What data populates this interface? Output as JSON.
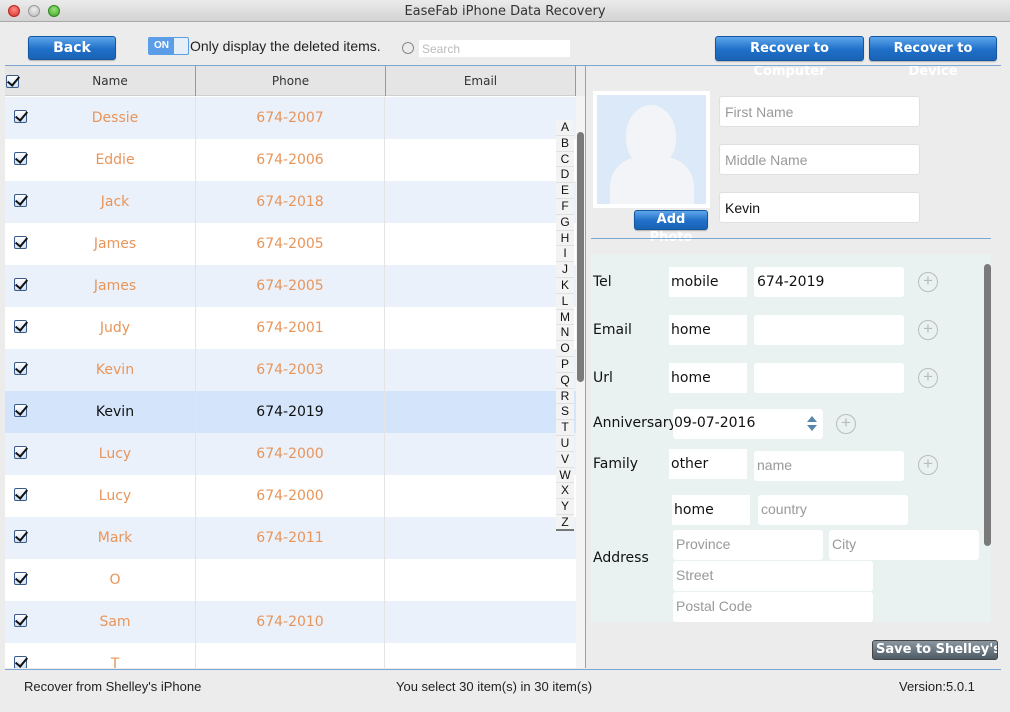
{
  "window": {
    "title": "EaseFab iPhone Data Recovery"
  },
  "toolbar": {
    "back_label": "Back",
    "toggle_state": "ON",
    "toggle_label": "Only display the deleted items.",
    "search_placeholder": "Search",
    "recover_computer_label": "Recover to Computer",
    "recover_device_label": "Recover to Device"
  },
  "table": {
    "headers": [
      "Name",
      "Phone",
      "Email"
    ],
    "rows": [
      {
        "name": "Dessie",
        "phone": "674-2007",
        "email": ""
      },
      {
        "name": "Eddie",
        "phone": "674-2006",
        "email": ""
      },
      {
        "name": "Jack",
        "phone": "674-2018",
        "email": ""
      },
      {
        "name": "James",
        "phone": "674-2005",
        "email": ""
      },
      {
        "name": "James",
        "phone": "674-2005",
        "email": ""
      },
      {
        "name": "Judy",
        "phone": "674-2001",
        "email": ""
      },
      {
        "name": "Kevin",
        "phone": "674-2003",
        "email": ""
      },
      {
        "name": "Kevin",
        "phone": "674-2019",
        "email": "",
        "selected": true
      },
      {
        "name": "Lucy",
        "phone": "674-2000",
        "email": ""
      },
      {
        "name": "Lucy",
        "phone": "674-2000",
        "email": ""
      },
      {
        "name": "Mark",
        "phone": "674-2011",
        "email": ""
      },
      {
        "name": "O",
        "phone": "",
        "email": ""
      },
      {
        "name": "Sam",
        "phone": "674-2010",
        "email": ""
      },
      {
        "name": "T",
        "phone": "",
        "email": ""
      }
    ],
    "alphabet": [
      "A",
      "B",
      "C",
      "D",
      "E",
      "F",
      "G",
      "H",
      "I",
      "J",
      "K",
      "L",
      "M",
      "N",
      "O",
      "P",
      "Q",
      "R",
      "S",
      "T",
      "U",
      "V",
      "W",
      "X",
      "Y",
      "Z"
    ]
  },
  "contact": {
    "add_photo_label": "Add Photo",
    "first_name_placeholder": "First Name",
    "middle_name_placeholder": "Middle Name",
    "last_name_value": "Kevin",
    "tel_label": "Tel",
    "tel_type": "mobile",
    "tel_value": "674-2019",
    "email_label": "Email",
    "email_type": "home",
    "email_value": "",
    "url_label": "Url",
    "url_type": "home",
    "url_value": "",
    "anniversary_label": "Anniversary",
    "anniversary_value": "09-07-2016",
    "family_label": "Family",
    "family_type": "other",
    "family_placeholder": "name",
    "address_label": "Address",
    "address_type": "home",
    "country_placeholder": "country",
    "province_placeholder": "Province",
    "city_placeholder": "City",
    "street_placeholder": "Street",
    "postal_placeholder": "Postal Code",
    "save_label": "Save to Shelley's iP"
  },
  "status": {
    "source": "Recover from Shelley's iPhone",
    "selection": "You select 30 item(s) in 30 item(s)",
    "version": "Version:5.0.1"
  },
  "colors": {
    "accent": "#1f6fc8",
    "deleted_text": "#e8955a",
    "divider": "#7ba7d3"
  }
}
